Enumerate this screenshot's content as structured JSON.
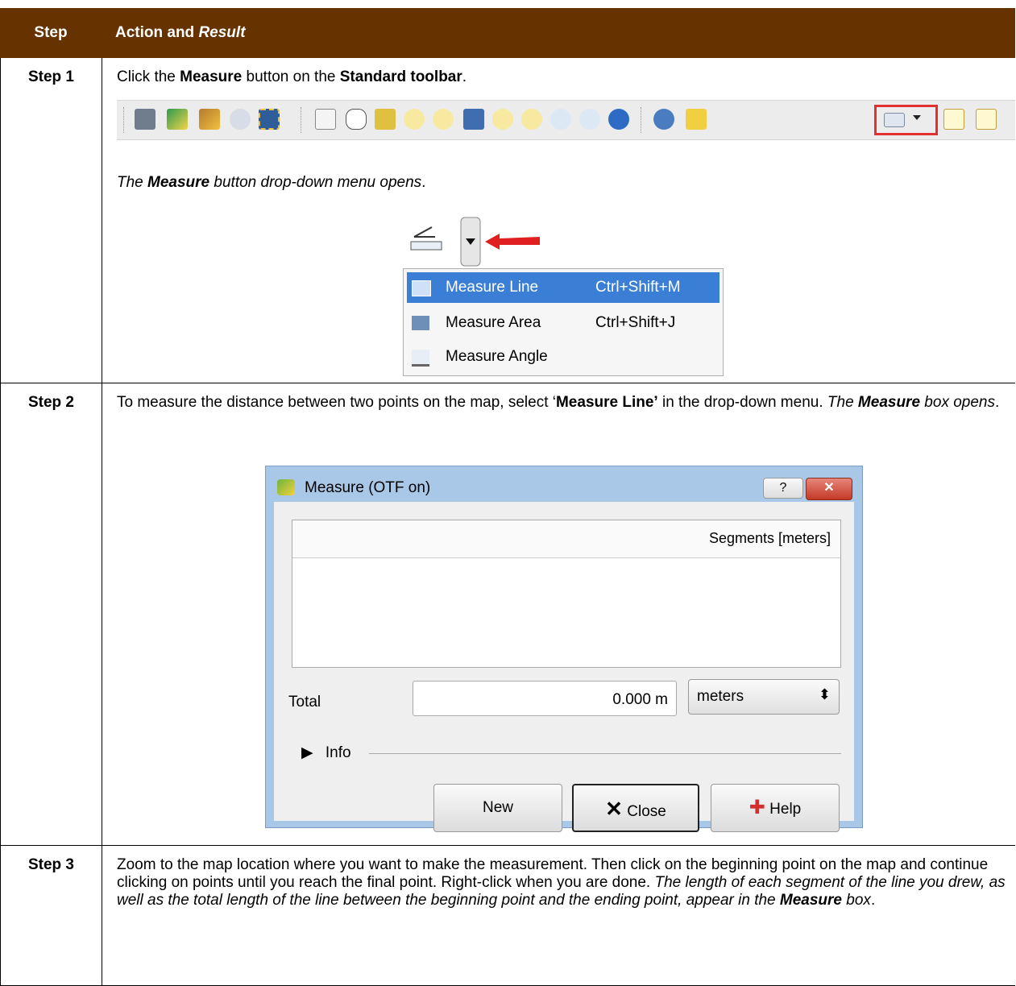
{
  "header": {
    "step": "Step",
    "action": "Action and ",
    "result": "Result"
  },
  "step1": {
    "label": "Step 1",
    "t1": "Click the ",
    "b1": "Measure",
    "t2": " button on the ",
    "b2": "Standard toolbar",
    "t3": ".",
    "r1": "The ",
    "rb": "Measure",
    "r2": " button drop-down menu opens",
    "r3": ".",
    "menu": [
      {
        "label": "Measure Line",
        "shortcut": "Ctrl+Shift+M"
      },
      {
        "label": "Measure Area",
        "shortcut": "Ctrl+Shift+J"
      },
      {
        "label": "Measure Angle",
        "shortcut": ""
      }
    ]
  },
  "step2": {
    "label": "Step 2",
    "t1": "To measure the distance between two points on the map, select ‘",
    "b1": "Measure Line’",
    "t2": " in the drop-down menu. ",
    "r1": "The ",
    "rb": "Measure",
    "r2": " box opens",
    "t3": ".",
    "dialog": {
      "title": "Measure (OTF on)",
      "help_btn": "?",
      "col_header": "Segments [meters]",
      "total_label": "Total",
      "total_value": "0.000 m",
      "unit": "meters",
      "info": "Info",
      "new_btn": "New",
      "close_btn": "Close",
      "help_label": "Help"
    }
  },
  "step3": {
    "label": "Step 3",
    "t1": "Zoom to the map location where you want to make the measurement. Then click on the beginning point on the map and continue clicking on points until you reach the final point. Right-click when you are done. ",
    "i1": "The length of each segment of the line you drew, as well as the total length of the line between the beginning point and the ending point, appear in the ",
    "ib": "Measure",
    "i2": " box",
    "t2": "."
  },
  "colors": {
    "header_bg": "#663300",
    "highlight": "#e03030",
    "menu_select": "#3a7fd5"
  },
  "toolbar_icons": [
    "save-icon",
    "new-map-icon",
    "broom-icon",
    "zoom-selection-icon",
    "select-icon",
    "touch-icon",
    "pan-icon",
    "pan-to-selection-icon",
    "zoom-in-icon",
    "zoom-out-icon",
    "zoom-full-icon",
    "zoom-layer-icon",
    "zoom-native-icon",
    "zoom-last-icon",
    "zoom-next-icon",
    "refresh-icon",
    "identify-icon",
    "deselect-icon",
    "measure-icon",
    "new-layer-icon",
    "new-shapefile-icon"
  ]
}
